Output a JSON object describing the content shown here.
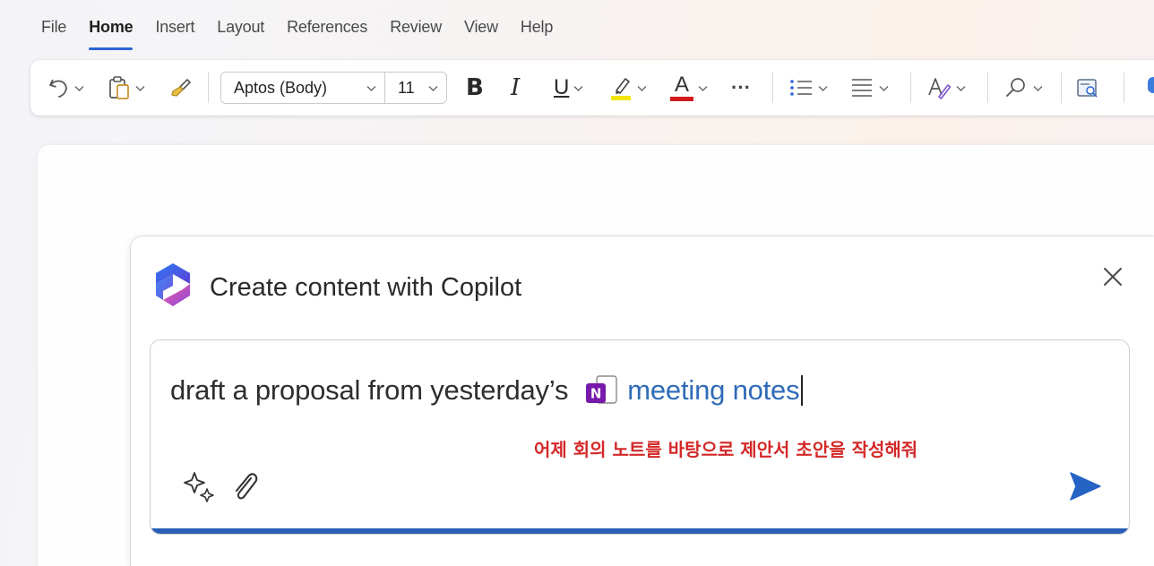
{
  "menu": {
    "tabs": [
      {
        "label": "File",
        "active": false
      },
      {
        "label": "Home",
        "active": true
      },
      {
        "label": "Insert",
        "active": false
      },
      {
        "label": "Layout",
        "active": false
      },
      {
        "label": "References",
        "active": false
      },
      {
        "label": "Review",
        "active": false
      },
      {
        "label": "View",
        "active": false
      },
      {
        "label": "Help",
        "active": false
      }
    ]
  },
  "ribbon": {
    "font_name": "Aptos (Body)",
    "font_size": "11",
    "bold_label": "B",
    "italic_label": "I",
    "underline_label": "U",
    "font_color_label": "A",
    "more_label": "···",
    "highlight_color": "#f2e600",
    "font_color": "#d11a1a",
    "icons": [
      "undo-icon",
      "paste-icon",
      "format-painter-icon",
      "highlighter-icon",
      "bullets-icon",
      "align-icon",
      "styles-icon",
      "find-icon",
      "reuse-files-icon",
      "dictate-icon"
    ]
  },
  "copilot": {
    "title": "Create content with Copilot",
    "prompt_text": "draft a proposal from yesterday’s",
    "file_reference": "meeting notes",
    "onenote_badge": "N",
    "caption_ko": "어제 회의 노트를 바탕으로 제안서 초안을 작성해줘",
    "accent_color": "#2a5fb8",
    "send_color": "#2563c4"
  }
}
